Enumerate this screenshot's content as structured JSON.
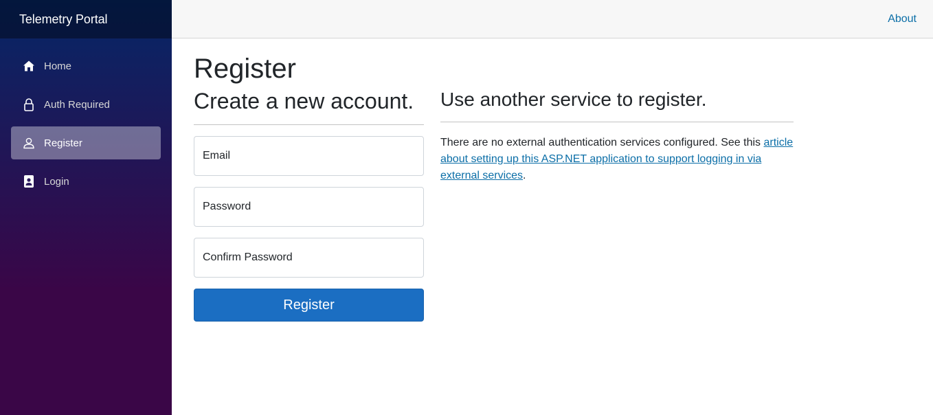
{
  "sidebar": {
    "brand": "Telemetry Portal",
    "items": [
      {
        "label": "Home",
        "icon": "home-icon",
        "active": false
      },
      {
        "label": "Auth Required",
        "icon": "lock-icon",
        "active": false
      },
      {
        "label": "Register",
        "icon": "person-icon",
        "active": true
      },
      {
        "label": "Login",
        "icon": "badge-icon",
        "active": false
      }
    ]
  },
  "header": {
    "about_label": "About"
  },
  "main": {
    "title": "Register",
    "register_form": {
      "heading": "Create a new account.",
      "email_label": "Email",
      "password_label": "Password",
      "confirm_password_label": "Confirm Password",
      "submit_label": "Register"
    },
    "external": {
      "heading": "Use another service to register.",
      "text_before": "There are no external authentication services configured. See this ",
      "link_text": "article about setting up this ASP.NET application to support logging in via external services",
      "text_after": "."
    }
  },
  "colors": {
    "primary_button": "#1b6ec2",
    "link": "#0b6ea7",
    "sidebar_top": "#052767",
    "sidebar_bottom": "#3a0647"
  }
}
